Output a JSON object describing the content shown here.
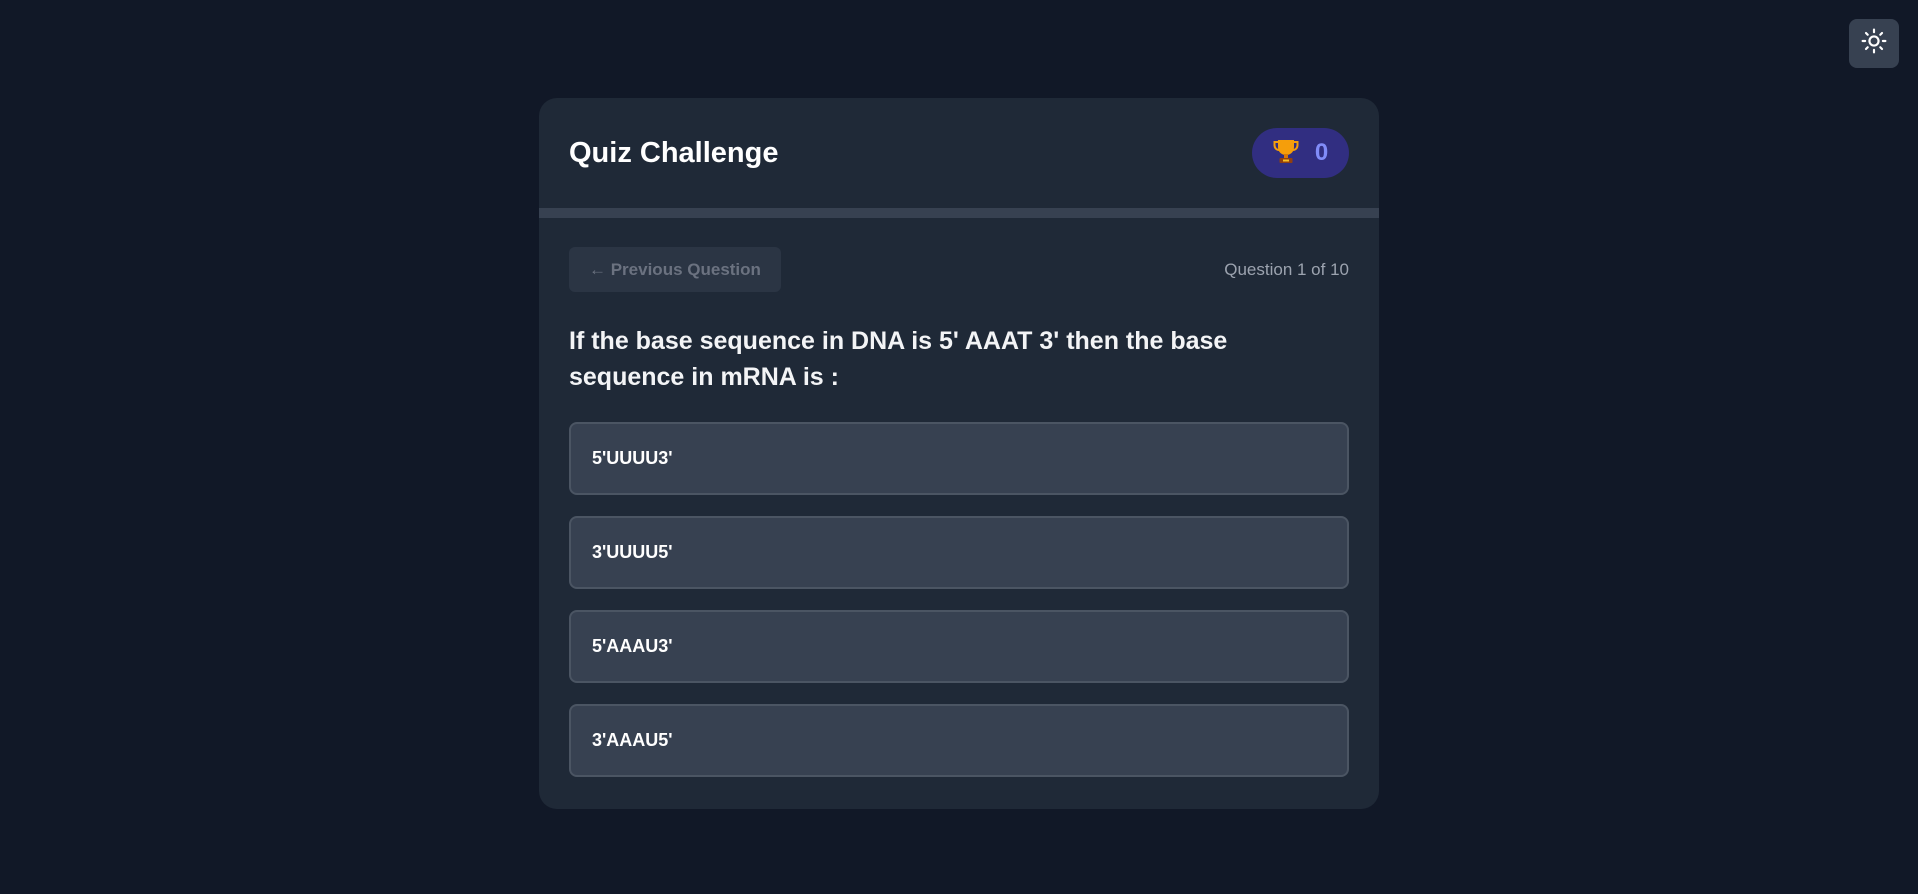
{
  "header": {
    "title": "Quiz Challenge",
    "score": "0",
    "score_icon": "trophy-icon"
  },
  "theme_toggle": {
    "icon": "sun-icon"
  },
  "progress": {
    "fraction": 0
  },
  "navigation": {
    "prev_label": "← Previous Question",
    "counter": "Question 1 of 10"
  },
  "question": {
    "text": "If the base sequence in DNA is 5' AAAT 3' then the base sequence in mRNA is :"
  },
  "options": [
    {
      "label": "5'UUUU3'"
    },
    {
      "label": "3'UUUU5'"
    },
    {
      "label": "5'AAAU3'"
    },
    {
      "label": "3'AAAU5'"
    }
  ],
  "colors": {
    "page_background": "#111827",
    "card_background": "#1f2937",
    "option_background": "#374151",
    "score_badge": "#312e81",
    "score_text": "#818cf8"
  }
}
